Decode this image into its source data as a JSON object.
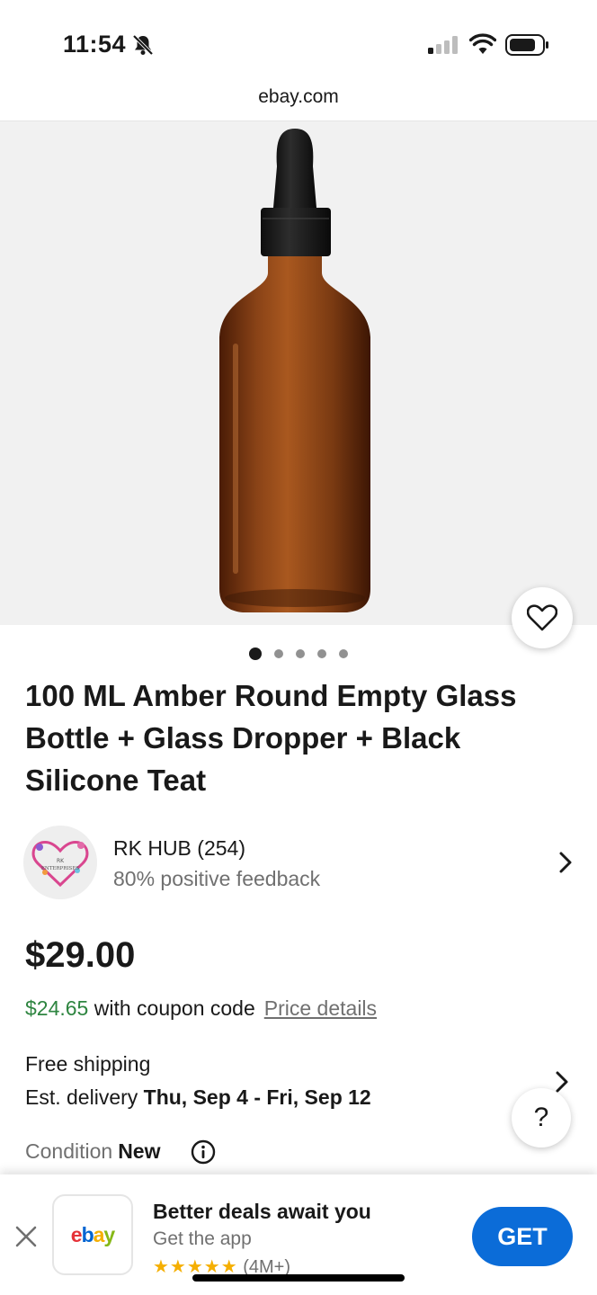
{
  "status_bar": {
    "time": "11:54",
    "icons": [
      "bell-off-icon",
      "signal-icon",
      "wifi-icon",
      "battery-icon"
    ]
  },
  "browser": {
    "url": "ebay.com"
  },
  "product": {
    "image_count": 5,
    "active_image_index": 0,
    "title": "100 ML Amber Round Empty Glass Bottle + Glass Dropper + Black Silicone Teat",
    "price": "$29.00",
    "coupon_price": "$24.65",
    "coupon_text": " with coupon code",
    "price_details_link": "Price details",
    "shipping": "Free shipping",
    "delivery_label": "Est. delivery ",
    "delivery_dates": "Thu, Sep 4 - Fri, Sep 12",
    "condition_label": "Condition",
    "condition_value": "New"
  },
  "seller": {
    "name": "RK HUB (254)",
    "feedback": "80% positive feedback",
    "avatar_text": "RK ENTERPRISES"
  },
  "help_button": {
    "label": "?"
  },
  "app_banner": {
    "title": "Better deals await you",
    "subtitle": "Get the app",
    "stars": "★★★★★",
    "rating_count": " (4M+)",
    "button_label": "GET",
    "logo": {
      "e": "e",
      "b": "b",
      "a": "a",
      "y": "y"
    }
  },
  "colors": {
    "accent_blue": "#0b6cd8",
    "coupon_green": "#2e8540",
    "bottle_amber": "#7a3a14"
  }
}
